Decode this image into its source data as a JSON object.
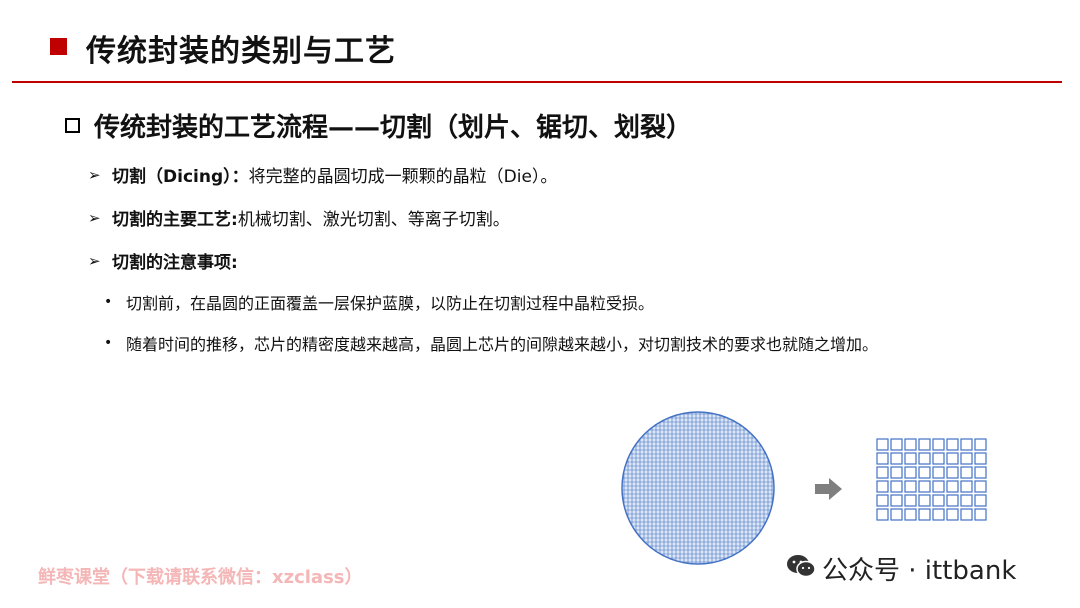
{
  "header": {
    "title": "传统封装的类别与工艺"
  },
  "section": {
    "heading": "传统封装的工艺流程——切割（划片、锯切、划裂）"
  },
  "bullets": [
    {
      "label": "切割（Dicing）：",
      "text": "将完整的晶圆切成一颗颗的晶粒（Die）。"
    },
    {
      "label": "切割的主要工艺:",
      "text": " 机械切割、激光切割、等离子切割。"
    },
    {
      "label": "切割的注意事项:",
      "text": ""
    }
  ],
  "sub_bullets": [
    "切割前，在晶圆的正面覆盖一层保护蓝膜，以防止在切割过程中晶粒受损。",
    "随着时间的推移，芯片的精密度越来越高，晶圆上芯片的间隙越来越小，对切割技术的要求也就随之增加。"
  ],
  "markers": {
    "arrow": "➢",
    "dot": "•"
  },
  "diagram": {
    "wafer_fill": "#dce6f5",
    "wafer_line": "#4472c4",
    "die_color": "#4472c4",
    "arrow_color": "#7f7f7f",
    "die_rows": 6,
    "die_cols": 8
  },
  "footer": {
    "watermark": "鲜枣课堂（下载请联系微信：xzclass）",
    "source": "公众号 · ittbank"
  },
  "colors": {
    "accent": "#c00000"
  }
}
